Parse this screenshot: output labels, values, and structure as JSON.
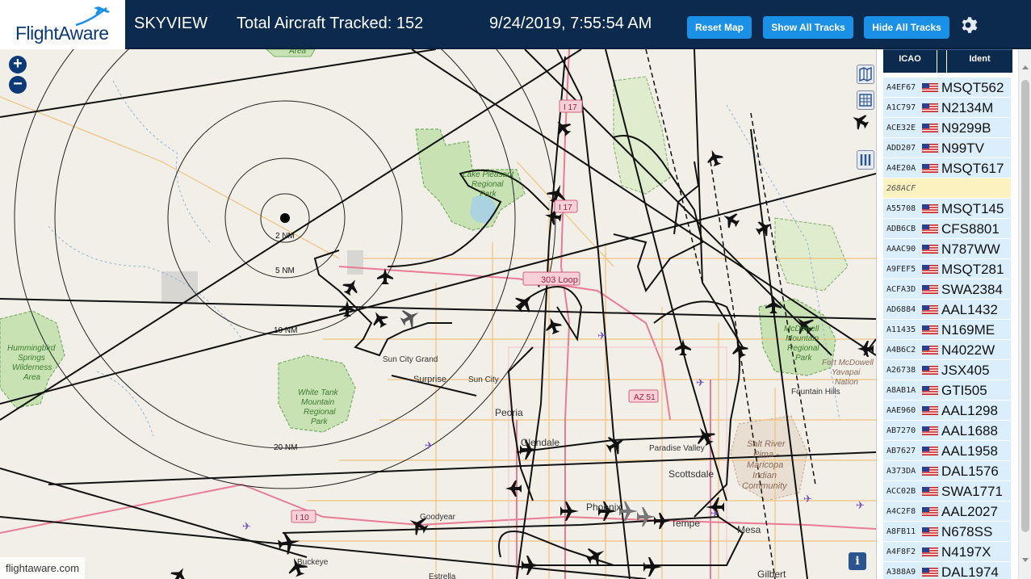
{
  "header": {
    "logo_text": "FlightAware",
    "app_title": "SKYVIEW",
    "total_tracked": "Total Aircraft Tracked: 152",
    "datetime": "9/24/2019, 7:55:54 AM",
    "buttons": {
      "reset_map": "Reset Map",
      "show_all_tracks": "Show All Tracks",
      "hide_all_tracks": "Hide All Tracks"
    },
    "settings_icon": "gear-icon"
  },
  "map": {
    "zoom_in": "+",
    "zoom_out": "−",
    "info_label": "i",
    "attribution": "flightaware.com",
    "range_rings": [
      "2 NM",
      "5 NM",
      "10 NM",
      "20 NM"
    ],
    "place_labels": {
      "lake_pleasant": [
        "Lake Pleasant",
        "Regional",
        "Park"
      ],
      "hummingbird": [
        "Hummingbird",
        "Springs",
        "Wilderness",
        "Area"
      ],
      "white_tank": [
        "White Tank",
        "Mountain",
        "Regional",
        "Park"
      ],
      "mcdowell": [
        "McDowell",
        "Mountain",
        "Regional",
        "Park"
      ],
      "fort_mcdowell": [
        "Fort McDowell",
        "Yavapai",
        "Nation"
      ],
      "salt_river": [
        "Salt River",
        "Pima -",
        "Maricopa",
        "Indian",
        "Community"
      ],
      "sun_city_grand": "Sun City Grand",
      "sun_city": "Sun City",
      "surprise": "Surprise",
      "peoria": "Peoria",
      "glendale": "Glendale",
      "paradise_valley": "Paradise Valley",
      "scottsdale": "Scottsdale",
      "fountain_hills": "Fountain Hills",
      "phoenix": "Phoenix",
      "tempe": "Tempe",
      "mesa": "Mesa",
      "goodyear": "Goodyear",
      "buckeye": "Buckeye",
      "estrella": "Estrella",
      "gilbert": "Gilbert",
      "area_top": "Area"
    },
    "road_shields": [
      "I 17",
      "I 17",
      "303 Loop",
      "AZ 51",
      "I 10"
    ]
  },
  "table": {
    "headers": {
      "icao": "ICAO",
      "ident": "Ident"
    },
    "rows": [
      {
        "icao": "A4EF67",
        "ident": "MSQT562",
        "flag": "us-flag-icon"
      },
      {
        "icao": "A1C797",
        "ident": "N2134M",
        "flag": "us-flag-icon"
      },
      {
        "icao": "ACE32E",
        "ident": "N9299B",
        "flag": "us-flag-icon"
      },
      {
        "icao": "ADD207",
        "ident": "N99TV",
        "flag": "us-flag-icon"
      },
      {
        "icao": "A4E20A",
        "ident": "MSQT617",
        "flag": "us-flag-icon"
      },
      {
        "icao": "268ACF",
        "ident": "",
        "flag": "",
        "highlight": true
      },
      {
        "icao": "A55708",
        "ident": "MSQT145",
        "flag": "us-flag-icon"
      },
      {
        "icao": "ADB6CB",
        "ident": "CFS8801",
        "flag": "us-flag-icon"
      },
      {
        "icao": "AAAC90",
        "ident": "N787WW",
        "flag": "us-flag-icon"
      },
      {
        "icao": "A9FEF5",
        "ident": "MSQT281",
        "flag": "us-flag-icon"
      },
      {
        "icao": "ACFA3D",
        "ident": "SWA2384",
        "flag": "us-flag-icon"
      },
      {
        "icao": "AD6884",
        "ident": "AAL1432",
        "flag": "us-flag-icon"
      },
      {
        "icao": "A11435",
        "ident": "N169ME",
        "flag": "us-flag-icon"
      },
      {
        "icao": "A4B6C2",
        "ident": "N4022W",
        "flag": "us-flag-icon"
      },
      {
        "icao": "A26738",
        "ident": "JSX405",
        "flag": "us-flag-icon"
      },
      {
        "icao": "A8AB1A",
        "ident": "GTI505",
        "flag": "us-flag-icon"
      },
      {
        "icao": "AAE960",
        "ident": "AAL1298",
        "flag": "us-flag-icon"
      },
      {
        "icao": "AB7270",
        "ident": "AAL1688",
        "flag": "us-flag-icon"
      },
      {
        "icao": "AB7627",
        "ident": "AAL1958",
        "flag": "us-flag-icon"
      },
      {
        "icao": "A373DA",
        "ident": "DAL1576",
        "flag": "us-flag-icon"
      },
      {
        "icao": "ACC02B",
        "ident": "SWA1771",
        "flag": "us-flag-icon"
      },
      {
        "icao": "A4C2F8",
        "ident": "AAL2027",
        "flag": "us-flag-icon"
      },
      {
        "icao": "A8FB11",
        "ident": "N678SS",
        "flag": "us-flag-icon"
      },
      {
        "icao": "A4F8F2",
        "ident": "N4197X",
        "flag": "us-flag-icon"
      },
      {
        "icao": "A388A9",
        "ident": "DAL1974",
        "flag": "us-flag-icon"
      }
    ]
  },
  "colors": {
    "header_bg": "#0c2a4d",
    "button_bg": "#1a90e6",
    "row_bg": "#dbeefb",
    "row_highlight": "#fcf2c0",
    "park": "#c8e2b4",
    "park_border": "#79b066",
    "highway": "#e97b95",
    "arterial": "#f3c27a"
  }
}
